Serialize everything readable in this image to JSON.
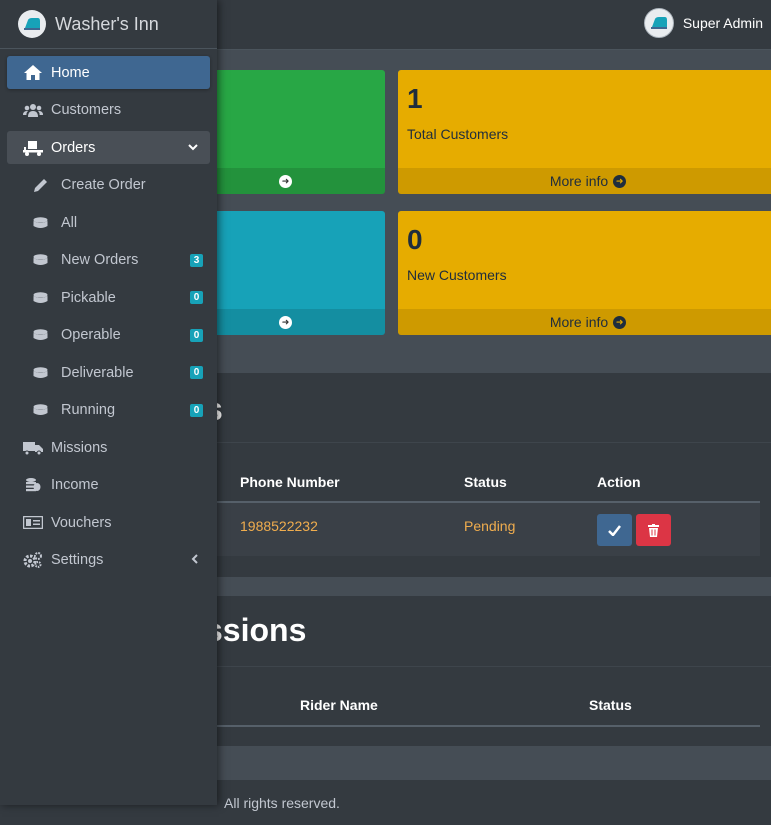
{
  "app": {
    "brand_name": "Washer's Inn",
    "user_name": "Super Admin"
  },
  "sidebar": {
    "items": [
      {
        "label": "Home",
        "icon": "home-icon",
        "active": true
      },
      {
        "label": "Customers",
        "icon": "users-icon"
      },
      {
        "label": "Orders",
        "icon": "dolly-icon",
        "expanded": true
      },
      {
        "label": "Create Order",
        "icon": "pencil-icon",
        "sub": true
      },
      {
        "label": "All",
        "icon": "database-icon",
        "sub": true
      },
      {
        "label": "New Orders",
        "icon": "database-icon",
        "sub": true,
        "badge": "3"
      },
      {
        "label": "Pickable",
        "icon": "database-icon",
        "sub": true,
        "badge": "0"
      },
      {
        "label": "Operable",
        "icon": "database-icon",
        "sub": true,
        "badge": "0"
      },
      {
        "label": "Deliverable",
        "icon": "database-icon",
        "sub": true,
        "badge": "0"
      },
      {
        "label": "Running",
        "icon": "database-icon",
        "sub": true,
        "badge": "0"
      },
      {
        "label": "Missions",
        "icon": "truck-icon"
      },
      {
        "label": "Income",
        "icon": "coins-icon"
      },
      {
        "label": "Vouchers",
        "icon": "money-bill-icon"
      },
      {
        "label": "Settings",
        "icon": "cogs-icon",
        "caret": "left"
      }
    ]
  },
  "stats": {
    "total_customers": {
      "value": "1",
      "label": "Total Customers",
      "more": "More info"
    },
    "new_customers": {
      "value": "0",
      "label": "New Customers",
      "more": "More info"
    }
  },
  "orders_card": {
    "title_visible": "s",
    "columns": [
      "Phone Number",
      "Status",
      "Action"
    ],
    "rows": [
      {
        "phone": "1988522232",
        "status": "Pending"
      }
    ]
  },
  "missions_card": {
    "title_visible": "ssions",
    "columns": [
      "Rider Name",
      "Status"
    ]
  },
  "footer": {
    "text": "All rights reserved."
  },
  "colors": {
    "primary": "#3f6791",
    "warning": "#e6ac00",
    "success": "#28a745",
    "info": "#17a2b8",
    "danger": "#dc3545",
    "sidebar": "#343a40"
  }
}
